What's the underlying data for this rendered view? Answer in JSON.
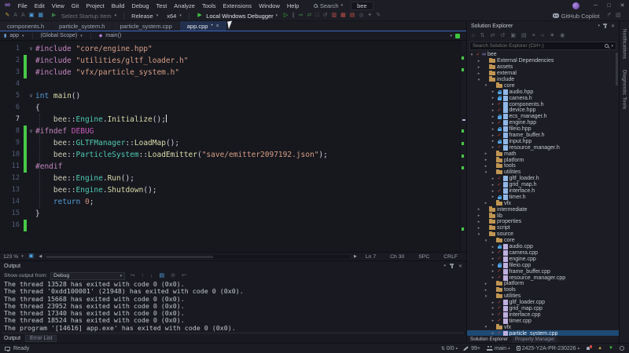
{
  "window": {
    "search_label": "Search",
    "solution_badge": "bee",
    "controls": [
      "minimize",
      "maximize",
      "close"
    ]
  },
  "menubar": {
    "items": [
      "File",
      "Edit",
      "View",
      "Git",
      "Project",
      "Build",
      "Debug",
      "Test",
      "Analyze",
      "Tools",
      "Extensions",
      "Window",
      "Help"
    ]
  },
  "toolbar": {
    "left_icons": [
      "quick-actions-icon",
      "find-prev-icon",
      "find-next-icon",
      "save-icon",
      "save-all-icon"
    ],
    "startup_item": "Select Startup Item",
    "config": "Release",
    "platform": "x64",
    "debug_button": "Local Windows Debugger",
    "run_icons": [
      "start-without-debugging-icon",
      "break-all-icon",
      "attach-to-process-icon",
      "reattach-icon",
      "stop-icon",
      "restart-icon",
      "profiler-icon",
      "memory-profiler-icon",
      "cpu-profiler-icon",
      "events-viewer-icon",
      "wrench-icon",
      "feedback-pen-icon"
    ],
    "copilot_label": "GitHub Copilot",
    "right_icons": [
      "share-icon",
      "send-feedback-icon"
    ]
  },
  "editor": {
    "tabs": [
      {
        "label": "components.h",
        "active": false
      },
      {
        "label": "particle_system.h",
        "active": false
      },
      {
        "label": "particle_system.cpp",
        "active": false
      },
      {
        "label": "app.cpp",
        "active": true,
        "modified": true
      }
    ],
    "breadcrumb": {
      "project": "app",
      "scope": "(Global Scope)",
      "symbol": "main()"
    },
    "statusline": {
      "zoom": "123 %",
      "line": "Ln 7",
      "column": "Ch 30",
      "spaces": "SPC",
      "eol": "CRLF"
    },
    "code": {
      "lines": [
        {
          "n": 1,
          "fold": true,
          "chg": false,
          "tokens": [
            [
              "pp",
              "#include"
            ],
            [
              "pl",
              " "
            ],
            [
              "str",
              "\"core/engine.hpp\""
            ]
          ]
        },
        {
          "n": 2,
          "chg": true,
          "tokens": [
            [
              "pp",
              "#include"
            ],
            [
              "pl",
              " "
            ],
            [
              "str",
              "\"utilities/gltf_loader.h\""
            ]
          ]
        },
        {
          "n": 3,
          "chg": true,
          "tokens": [
            [
              "pp",
              "#include"
            ],
            [
              "pl",
              " "
            ],
            [
              "str",
              "\"vfx/particle_system.h\""
            ]
          ]
        },
        {
          "n": 4,
          "tokens": []
        },
        {
          "n": 5,
          "fold": true,
          "tokens": [
            [
              "kw",
              "int"
            ],
            [
              "pl",
              " "
            ],
            [
              "fn",
              "main"
            ],
            [
              "pl",
              "()"
            ]
          ]
        },
        {
          "n": 6,
          "tokens": [
            [
              "pl",
              "{"
            ]
          ]
        },
        {
          "n": 7,
          "current": true,
          "cursor": true,
          "tokens": [
            [
              "pl",
              "    "
            ],
            [
              "ns",
              "bee"
            ],
            [
              "pl",
              "::"
            ],
            [
              "ty",
              "Engine"
            ],
            [
              "pl",
              "."
            ],
            [
              "fn",
              "Initialize"
            ],
            [
              "pl",
              "();"
            ]
          ]
        },
        {
          "n": 8,
          "fold": true,
          "chg": true,
          "tokens": [
            [
              "pp",
              "#ifndef"
            ],
            [
              "pl",
              " "
            ],
            [
              "mac",
              "DEBUG"
            ]
          ]
        },
        {
          "n": 9,
          "chg": true,
          "tokens": [
            [
              "pl",
              "    "
            ],
            [
              "ns",
              "bee"
            ],
            [
              "pl",
              "::"
            ],
            [
              "ty",
              "GLTFManager"
            ],
            [
              "pl",
              "::"
            ],
            [
              "fn",
              "LoadMap"
            ],
            [
              "pl",
              "();"
            ]
          ]
        },
        {
          "n": 10,
          "chg": true,
          "tokens": [
            [
              "pl",
              "    "
            ],
            [
              "ns",
              "bee"
            ],
            [
              "pl",
              "::"
            ],
            [
              "ty",
              "ParticleSystem"
            ],
            [
              "pl",
              "::"
            ],
            [
              "fn",
              "LoadEmitter"
            ],
            [
              "pl",
              "("
            ],
            [
              "str",
              "\"save/emitter2097192.json\""
            ],
            [
              "pl",
              ");"
            ]
          ]
        },
        {
          "n": 11,
          "chg": true,
          "tokens": [
            [
              "pp",
              "#endif"
            ]
          ]
        },
        {
          "n": 12,
          "tokens": [
            [
              "pl",
              "    "
            ],
            [
              "ns",
              "bee"
            ],
            [
              "pl",
              "::"
            ],
            [
              "ty",
              "Engine"
            ],
            [
              "pl",
              "."
            ],
            [
              "fn",
              "Run"
            ],
            [
              "pl",
              "();"
            ]
          ]
        },
        {
          "n": 13,
          "tokens": [
            [
              "pl",
              "    "
            ],
            [
              "ns",
              "bee"
            ],
            [
              "pl",
              "::"
            ],
            [
              "ty",
              "Engine"
            ],
            [
              "pl",
              "."
            ],
            [
              "fn",
              "Shutdown"
            ],
            [
              "pl",
              "();"
            ]
          ]
        },
        {
          "n": 14,
          "tokens": [
            [
              "pl",
              "    "
            ],
            [
              "kw",
              "return"
            ],
            [
              "pl",
              " "
            ],
            [
              "num",
              "0"
            ],
            [
              "pl",
              ";"
            ]
          ]
        },
        {
          "n": 15,
          "tokens": [
            [
              "pl",
              "}"
            ]
          ]
        },
        {
          "n": 16,
          "chg": true,
          "tokens": []
        }
      ]
    }
  },
  "output": {
    "title": "Output",
    "header_icons": [
      "chevron-down-icon",
      "pin-icon",
      "close-icon"
    ],
    "show_from_label": "Show output from:",
    "source": "Debug",
    "control_icons": [
      "jump-to-source-icon",
      "previous-message-icon",
      "next-message-icon",
      "messages-icon",
      "clear-all-icon",
      "toggle-wordwrap-icon"
    ],
    "lines": [
      "The thread 13528 has exited with code 0 (0x0).",
      "The thread '0xdd100001' (21948) has exited with code 0 (0x0).",
      "The thread 15668 has exited with code 0 (0x0).",
      "The thread 23952 has exited with code 0 (0x0).",
      "The thread 17340 has exited with code 0 (0x0).",
      "The thread 18524 has exited with code 0 (0x0).",
      "The program '[14616] app.exe' has exited with code 0 (0x0)."
    ],
    "tabs": [
      "Output",
      "Error List"
    ]
  },
  "solution_explorer": {
    "title": "Solution Explorer",
    "header_icons": [
      "chevron-down-icon",
      "pin-icon",
      "close-icon"
    ],
    "toolbar_icons": [
      "switch-views-icon",
      "pending-changes-filter-icon",
      "sync-with-active-document-icon",
      "refresh-icon",
      "nest-objects-icon",
      "show-all-files-icon",
      "collapse-all-icon",
      "view-code-icon",
      "properties-icon",
      "preview-selected-items-icon"
    ],
    "search_placeholder": "Search Solution Explorer (Ctrl+;)",
    "tree": [
      {
        "label": "bee",
        "level": 0,
        "arrow": "exp",
        "icon": "solution",
        "status": "check"
      },
      {
        "label": "External Dependencies",
        "level": 1,
        "arrow": "col",
        "icon": "folder"
      },
      {
        "label": "assets",
        "level": 1,
        "arrow": "col",
        "icon": "folder"
      },
      {
        "label": "external",
        "level": 1,
        "arrow": "col",
        "icon": "folder"
      },
      {
        "label": "include",
        "level": 1,
        "arrow": "exp",
        "icon": "folder"
      },
      {
        "label": "core",
        "level": 2,
        "arrow": "exp",
        "icon": "folder"
      },
      {
        "label": "audio.hpp",
        "level": 3,
        "arrow": "col",
        "icon": "h",
        "status": "lock"
      },
      {
        "label": "camera.h",
        "level": 3,
        "arrow": "col",
        "icon": "h",
        "status": "lock"
      },
      {
        "label": "components.h",
        "level": 3,
        "arrow": "col",
        "icon": "h",
        "status": "check"
      },
      {
        "label": "device.hpp",
        "level": 3,
        "arrow": "col",
        "icon": "h",
        "status": "check"
      },
      {
        "label": "ecs_manager.h",
        "level": 3,
        "arrow": "col",
        "icon": "h",
        "status": "lock"
      },
      {
        "label": "engine.hpp",
        "level": 3,
        "arrow": "col",
        "icon": "h",
        "status": "check"
      },
      {
        "label": "fileio.hpp",
        "level": 3,
        "arrow": "col",
        "icon": "h",
        "status": "lock"
      },
      {
        "label": "frame_buffer.h",
        "level": 3,
        "arrow": "col",
        "icon": "h",
        "status": "check"
      },
      {
        "label": "input.hpp",
        "level": 3,
        "arrow": "col",
        "icon": "h",
        "status": "lock"
      },
      {
        "label": "resource_manager.h",
        "level": 3,
        "arrow": "col",
        "icon": "h",
        "status": "check"
      },
      {
        "label": "math",
        "level": 2,
        "arrow": "col",
        "icon": "folder"
      },
      {
        "label": "platform",
        "level": 2,
        "arrow": "col",
        "icon": "folder"
      },
      {
        "label": "tools",
        "level": 2,
        "arrow": "col",
        "icon": "folder"
      },
      {
        "label": "utilities",
        "level": 2,
        "arrow": "exp",
        "icon": "folder"
      },
      {
        "label": "gltf_loader.h",
        "level": 3,
        "arrow": "col",
        "icon": "h",
        "status": "check"
      },
      {
        "label": "grid_map.h",
        "level": 3,
        "arrow": "col",
        "icon": "h",
        "status": "check"
      },
      {
        "label": "interface.h",
        "level": 3,
        "arrow": "col",
        "icon": "h",
        "status": "check"
      },
      {
        "label": "timer.h",
        "level": 3,
        "arrow": "col",
        "icon": "h",
        "status": "lock"
      },
      {
        "label": "vfx",
        "level": 2,
        "arrow": "col",
        "icon": "folder"
      },
      {
        "label": "intermediate",
        "level": 1,
        "arrow": "col",
        "icon": "folder"
      },
      {
        "label": "lib",
        "level": 1,
        "arrow": "col",
        "icon": "folder"
      },
      {
        "label": "properties",
        "level": 1,
        "arrow": "col",
        "icon": "folder"
      },
      {
        "label": "script",
        "level": 1,
        "arrow": "col",
        "icon": "folder"
      },
      {
        "label": "source",
        "level": 1,
        "arrow": "exp",
        "icon": "folder"
      },
      {
        "label": "core",
        "level": 2,
        "arrow": "exp",
        "icon": "folder"
      },
      {
        "label": "audio.cpp",
        "level": 3,
        "arrow": "col",
        "icon": "cpp",
        "status": "lock"
      },
      {
        "label": "camera.cpp",
        "level": 3,
        "arrow": "col",
        "icon": "cpp",
        "status": "check"
      },
      {
        "label": "engine.cpp",
        "level": 3,
        "arrow": "col",
        "icon": "cpp",
        "status": "check"
      },
      {
        "label": "fileio.cpp",
        "level": 3,
        "arrow": "col",
        "icon": "cpp",
        "status": "lock"
      },
      {
        "label": "frame_buffer.cpp",
        "level": 3,
        "arrow": "col",
        "icon": "cpp",
        "status": "check"
      },
      {
        "label": "resource_manager.cpp",
        "level": 3,
        "arrow": "col",
        "icon": "cpp",
        "status": "check"
      },
      {
        "label": "platform",
        "level": 2,
        "arrow": "col",
        "icon": "folder"
      },
      {
        "label": "tools",
        "level": 2,
        "arrow": "col",
        "icon": "folder"
      },
      {
        "label": "utilities",
        "level": 2,
        "arrow": "exp",
        "icon": "folder"
      },
      {
        "label": "gltf_loader.cpp",
        "level": 3,
        "arrow": "col",
        "icon": "cpp",
        "status": "check"
      },
      {
        "label": "grid_map.cpp",
        "level": 3,
        "arrow": "col",
        "icon": "cpp",
        "status": "check"
      },
      {
        "label": "interface.cpp",
        "level": 3,
        "arrow": "col",
        "icon": "cpp",
        "status": "check"
      },
      {
        "label": "timer.cpp",
        "level": 3,
        "arrow": "col",
        "icon": "cpp",
        "status": "check"
      },
      {
        "label": "vfx",
        "level": 2,
        "arrow": "exp",
        "icon": "folder"
      },
      {
        "label": "particle_system.cpp",
        "level": 3,
        "arrow": "col",
        "icon": "cpp",
        "status": "check",
        "selected": true
      }
    ],
    "bottom_tabs": [
      "Solution Explorer",
      "Property Manager"
    ]
  },
  "right_strip": {
    "tabs": [
      "Notifications",
      "Diagnostic Tools"
    ]
  },
  "statusbar": {
    "ready": "Ready",
    "nav_count": "0/0",
    "edit_count": "99+",
    "branch": "main",
    "repo": "2425-Y2A-PR-230226"
  },
  "colors": {
    "accent_blue": "#3D66BD",
    "change_green": "#47C947",
    "folder_gold": "#C09553",
    "status_check_red": "#D24A43",
    "status_lock_blue": "#4FA3E3",
    "selection_blue": "#1F4A74",
    "run_green": "#3EC43E"
  }
}
